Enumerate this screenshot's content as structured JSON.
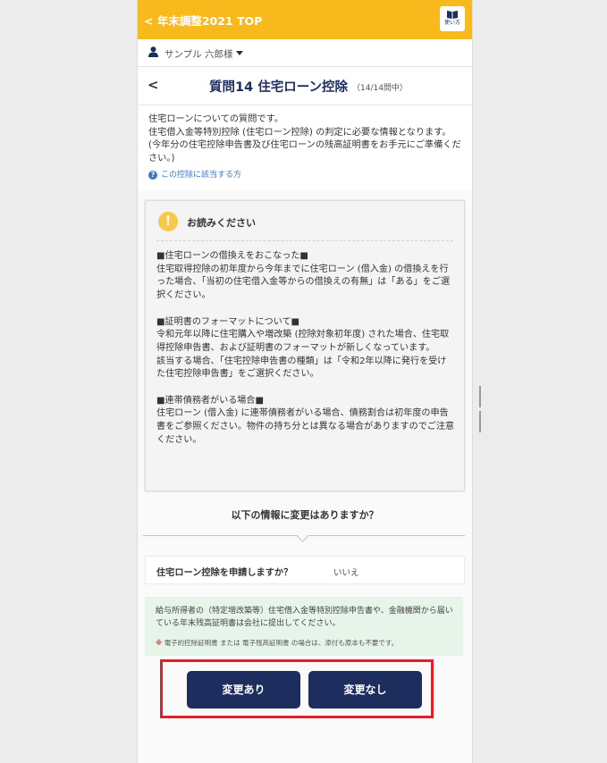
{
  "header": {
    "back_link": "< 年末調整2021 TOP",
    "guide_label": "使い方"
  },
  "user": {
    "name": "サンプル 六郎様"
  },
  "question_header": {
    "back_symbol": "<",
    "title": "質問14 住宅ローン控除",
    "progress": "（14/14問中）"
  },
  "intro": {
    "text": "住宅ローンについての質問です。\n住宅借入金等特別控除 (住宅ローン控除) の判定に必要な情報となります。(今年分の住宅控除申告書及び住宅ローンの残高証明書をお手元にご準備ください。)",
    "help_link": "この控除に該当する方"
  },
  "notice": {
    "title": "お読みください",
    "paragraphs": [
      "■住宅ローンの借換えをおこなった■\n住宅取得控除の初年度から今年までに住宅ローン (借入金) の借換えを行った場合、「当初の住宅借入金等からの借換えの有無」は「ある」をご選択ください。",
      "■証明書のフォーマットについて■\n令和元年以降に住宅購入や増改築 (控除対象初年度) された場合、住宅取得控除申告書、および証明書のフォーマットが新しくなっています。\n該当する場合、「住宅控除申告書の種類」は「令和2年以降に発行を受けた住宅控除申告書」をご選択ください。",
      "■連帯債務者がいる場合■\n住宅ローン (借入金) に連帯債務者がいる場合、債務割合は初年度の申告書をご参照ください。物件の持ち分とは異なる場合がありますのでご注意ください。"
    ]
  },
  "question": "以下の情報に変更はありますか？",
  "answer": {
    "question": "住宅ローン控除を申請しますか？",
    "value": "いいえ"
  },
  "info": {
    "text": "給与所得者の（特定増改築等）住宅借入金等特別控除申告書や、金融機関から届いている年末残高証明書は会社に提出してください。",
    "note_mark": "※",
    "note": "電子的控除証明書 または 電子残高証明書 の場合は、添付も原本も不要です。"
  },
  "buttons": {
    "change_yes": "変更あり",
    "change_no": "変更なし"
  },
  "colors": {
    "header": "#f7b91c",
    "navy": "#1c2d5e",
    "highlight": "#e3202a",
    "info_bg": "#e7f4ea"
  }
}
